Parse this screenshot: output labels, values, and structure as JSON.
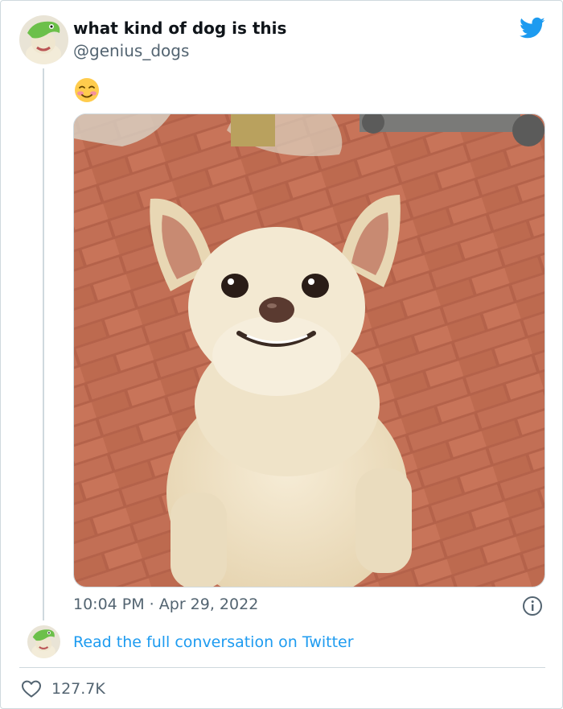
{
  "tweet": {
    "display_name": "what kind of dog is this",
    "handle": "@genius_dogs",
    "text_emoji": "☺️",
    "timestamp": "10:04 PM · Apr 29, 2022",
    "read_more_label": "Read the full conversation on Twitter",
    "likes": "127.7K"
  },
  "icons": {
    "brand": "twitter-bird-icon",
    "info": "info-icon",
    "like": "heart-icon"
  },
  "colors": {
    "accent": "#1d9bf0",
    "secondary_text": "#536471",
    "border": "#cfd9de"
  }
}
